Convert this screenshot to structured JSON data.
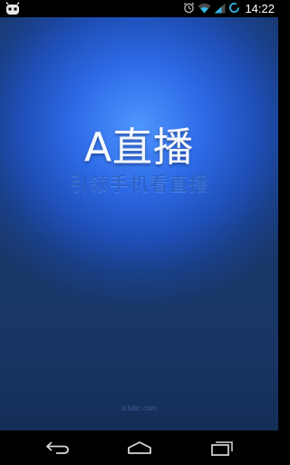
{
  "status_bar": {
    "time": "14:22",
    "icons": [
      "android-robot-icon",
      "alarm-icon",
      "wifi-icon",
      "signal-icon",
      "sync-icon"
    ]
  },
  "splash": {
    "title": "A直播",
    "slogan": "引领手机看直播",
    "site": "a.fabc.com"
  },
  "nav_bar": {
    "buttons": [
      "back-icon",
      "home-icon",
      "recents-icon"
    ]
  },
  "colors": {
    "gradient_center": "#4f96ff",
    "gradient_mid": "#1f4fb8",
    "gradient_edge": "#183769",
    "slogan": "#2c5fc0",
    "title": "#f4f8ff"
  }
}
